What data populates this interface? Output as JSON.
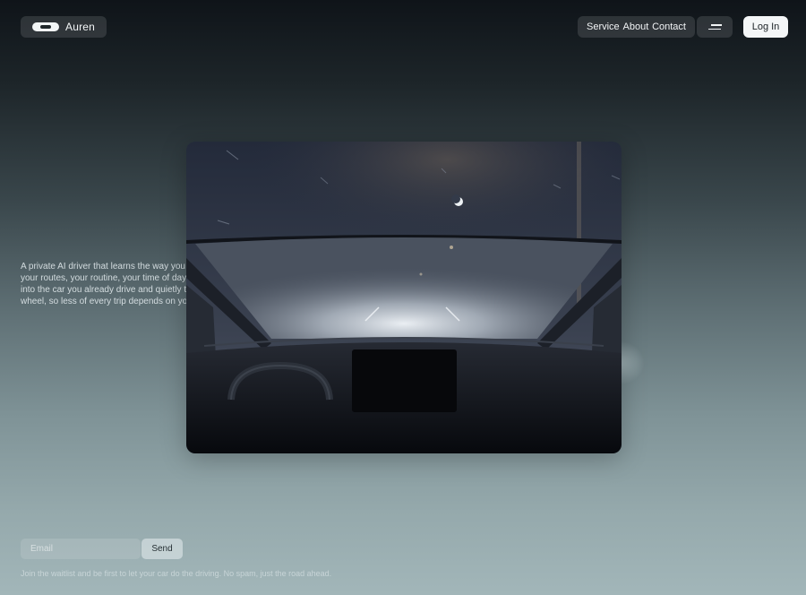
{
  "brand": {
    "name": "Auren"
  },
  "nav": {
    "links": [
      "Service",
      "About",
      "Contact"
    ],
    "login_label": "Log In"
  },
  "intro": {
    "lines": [
      "A private AI driver that learns the way you m",
      "your routes, your routine, your time of day. I",
      "into the car you already drive and quietly tal",
      "wheel, so less of every trip depends on you"
    ]
  },
  "waitlist": {
    "email_placeholder": "Email",
    "send_label": "Send",
    "footnote": "Join the waitlist and be first to let your car do the driving. No spam, just the road ahead."
  },
  "hero": {
    "description_icon": "car-interior-night-image"
  },
  "colors": {
    "login_bg": "#f4f6f7",
    "pill_bg": "rgba(255,255,255,0.12)",
    "bg_top": "#0f1419",
    "bg_bottom": "#a2b6b9"
  }
}
